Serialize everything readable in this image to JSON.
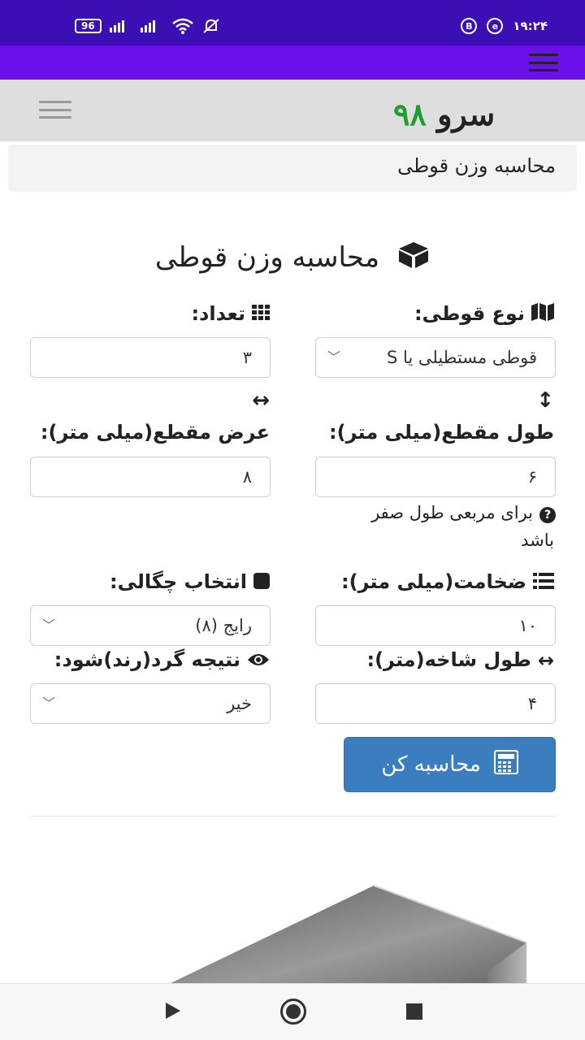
{
  "status_bar": {
    "battery": "96",
    "time": "۱۹:۲۴",
    "b_badge": "B",
    "e_badge": "e"
  },
  "site": {
    "logo_word": "سرو",
    "logo_number": "۹۸"
  },
  "breadcrumb": {
    "text": "محاسبه وزن قوطی"
  },
  "page": {
    "title": "محاسبه وزن قوطی"
  },
  "form": {
    "box_type": {
      "label": "نوع قوطی:",
      "value": "قوطی مستطیلی یا S"
    },
    "count": {
      "label": "تعداد:",
      "value": "۳"
    },
    "length_section": {
      "label": "طول مقطع(میلی متر):",
      "value": "۶",
      "hint": "برای مربعی طول صفر",
      "hint_line2": "باشد"
    },
    "width_section": {
      "label": "عرض مقطع(میلی متر):",
      "value": "۸"
    },
    "thickness": {
      "label": "ضخامت(میلی متر):",
      "value": "۱۰"
    },
    "density": {
      "label": "انتخاب چگالی:",
      "value": "رایج (۸)"
    },
    "branch_length": {
      "label": "طول شاخه(متر):",
      "value": "۴"
    },
    "rounding": {
      "label": "نتیجه گرد(رند)شود:",
      "value": "خیر"
    },
    "submit_label": "محاسبه کن"
  },
  "colors": {
    "status_bar": "#3b0fb3",
    "top_bar": "#6a10e8",
    "header": "#dedede",
    "button": "#3a7ec0",
    "logo_number": "#1e9e2a"
  }
}
